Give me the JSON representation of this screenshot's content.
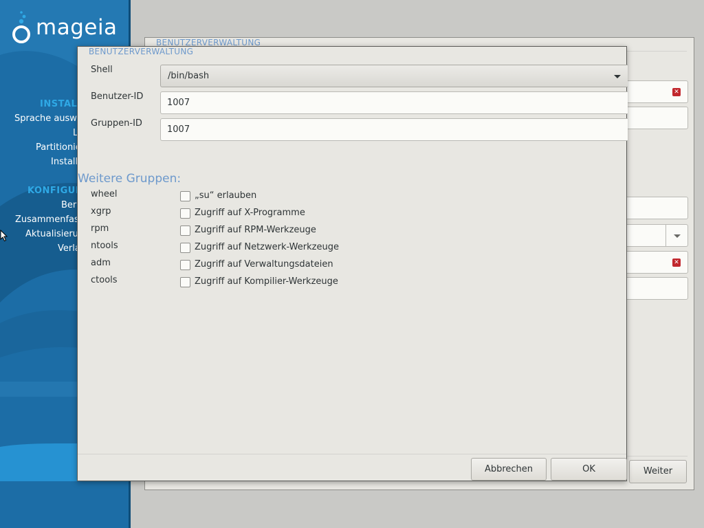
{
  "sidebar": {
    "brand": "mageia",
    "sections": [
      {
        "label": "INSTALL"
      },
      {
        "label": "KONFIGUR"
      }
    ],
    "items": [
      {
        "label": "Sprache ausw"
      },
      {
        "label": "L"
      },
      {
        "label": "Partitionie"
      },
      {
        "label": "Install"
      },
      {
        "label": "Ber"
      },
      {
        "label": "Zusammenfas"
      },
      {
        "label": "Aktualisieru"
      },
      {
        "label": "Verla"
      }
    ]
  },
  "background_window": {
    "title": "BENUTZERVERWALTUNG",
    "next_button": "Weiter"
  },
  "dialog": {
    "title": "BENUTZERVERWALTUNG",
    "shell": {
      "label": "Shell",
      "value": "/bin/bash"
    },
    "user_id": {
      "label": "Benutzer-ID",
      "value": "1007"
    },
    "group_id": {
      "label": "Gruppen-ID",
      "value": "1007"
    },
    "groups_heading": "Weitere Gruppen:",
    "groups": [
      {
        "name": "wheel",
        "label": "„su“ erlauben",
        "checked": false
      },
      {
        "name": "xgrp",
        "label": "Zugriff auf X-Programme",
        "checked": false
      },
      {
        "name": "rpm",
        "label": "Zugriff auf RPM-Werkzeuge",
        "checked": false
      },
      {
        "name": "ntools",
        "label": "Zugriff auf Netzwerk-Werkzeuge",
        "checked": false
      },
      {
        "name": "adm",
        "label": "Zugriff auf Verwaltungsdateien",
        "checked": false
      },
      {
        "name": "ctools",
        "label": "Zugriff auf Kompilier-Werkzeuge",
        "checked": false
      }
    ],
    "cancel_button": "Abbrechen",
    "ok_button": "OK"
  },
  "colors": {
    "sidebar_bg": "#1c6da6",
    "accent_heading": "#6d99cc",
    "sidebar_heading": "#2fa9e6",
    "error": "#c1272d"
  }
}
